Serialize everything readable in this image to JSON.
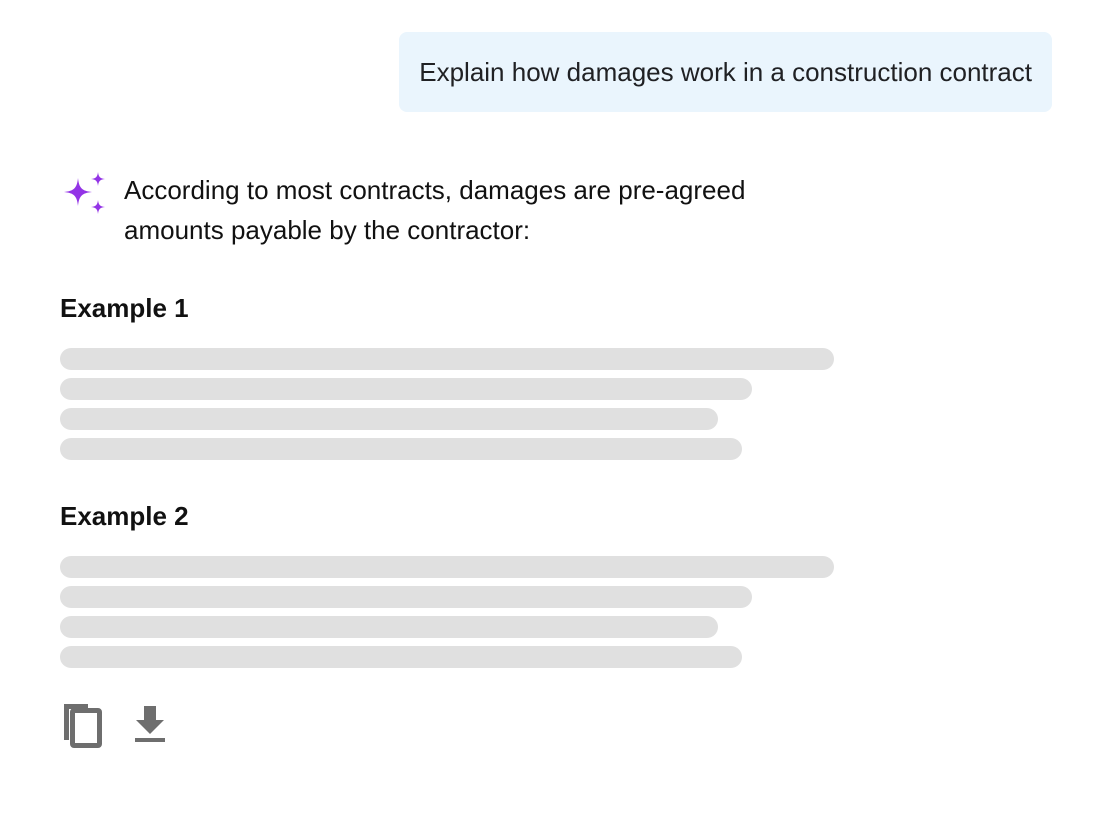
{
  "user_message": "Explain how damages work in a construction contract",
  "assistant": {
    "intro": "According to most contracts, damages are pre-agreed amounts payable by the contractor:"
  },
  "sections": [
    {
      "title": "Example 1"
    },
    {
      "title": "Example 2"
    }
  ],
  "icons": {
    "assistant": "sparkle-icon",
    "copy": "copy-icon",
    "download": "download-icon"
  },
  "colors": {
    "accent": "#9334e6",
    "user_bubble": "#eaf5fd",
    "skeleton": "#e0e0e0",
    "icon": "#6e6e6e"
  }
}
